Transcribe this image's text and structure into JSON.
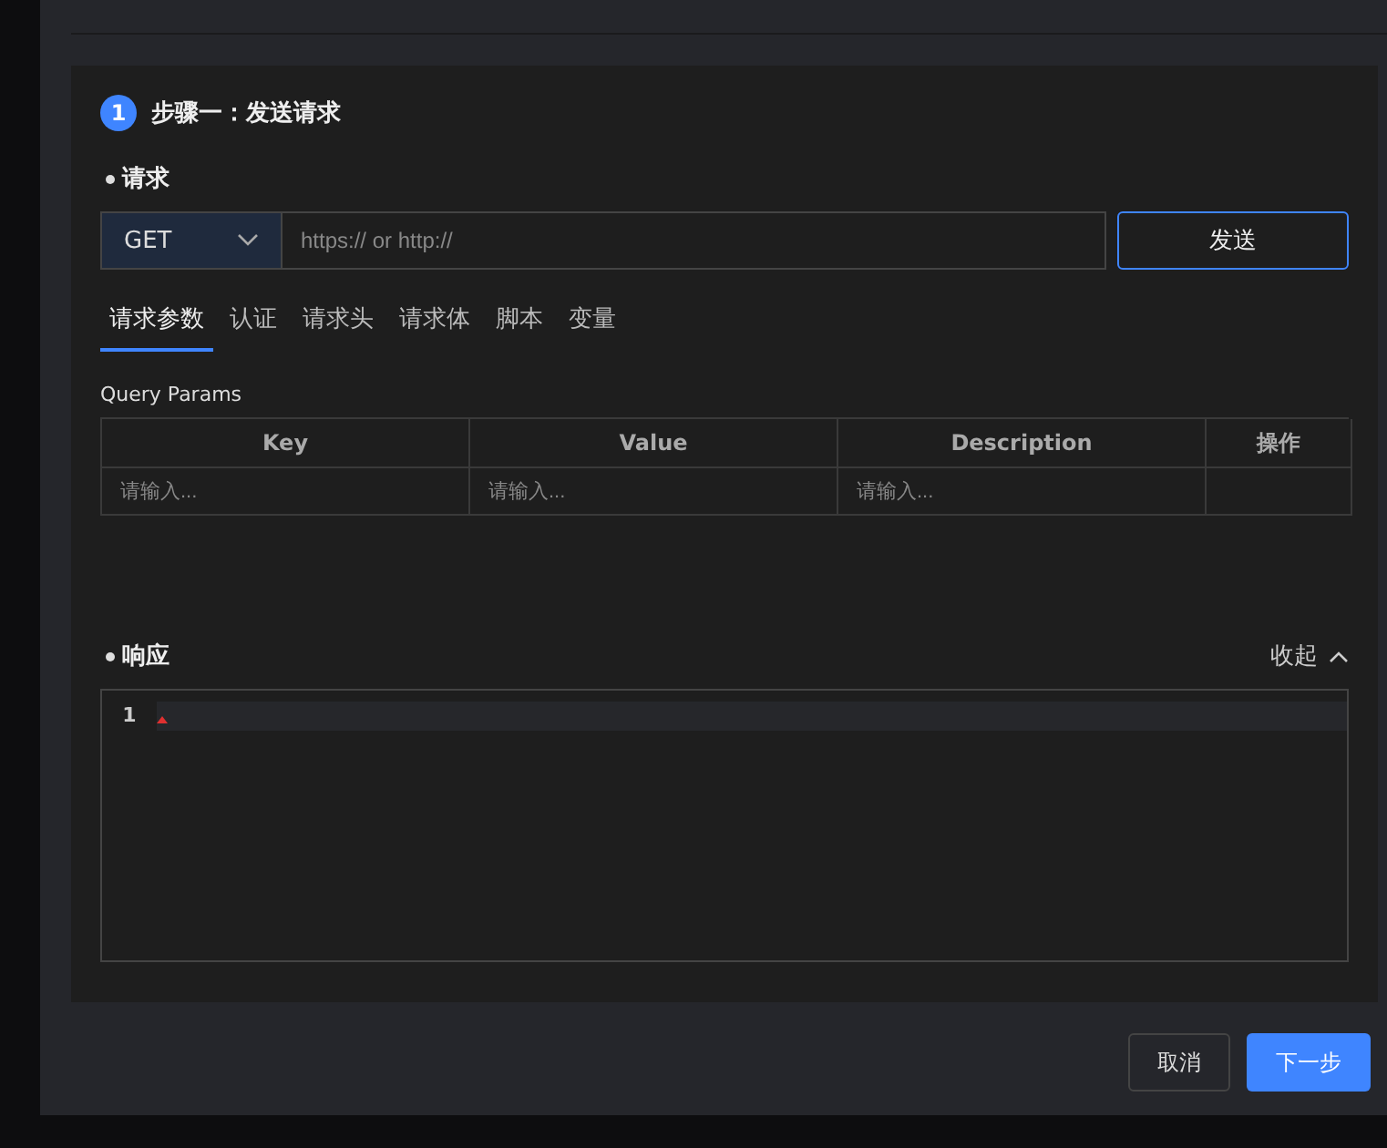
{
  "step": {
    "number": "1",
    "title": "步骤一：发送请求"
  },
  "request": {
    "label": "请求",
    "method": "GET",
    "url_placeholder": "https:// or http://",
    "send": "发送"
  },
  "tabs": [
    {
      "label": "请求参数",
      "selected": true
    },
    {
      "label": "认证",
      "selected": false
    },
    {
      "label": "请求头",
      "selected": false
    },
    {
      "label": "请求体",
      "selected": false
    },
    {
      "label": "脚本",
      "selected": false
    },
    {
      "label": "变量",
      "selected": false
    }
  ],
  "query_params": {
    "title": "Query Params",
    "columns": [
      "Key",
      "Value",
      "Description",
      "操作"
    ],
    "rows": [
      {
        "placeholders": [
          "请输入...",
          "请输入...",
          "请输入..."
        ]
      }
    ]
  },
  "response": {
    "label": "响应",
    "toggle": "收起",
    "line_numbers": [
      "1"
    ]
  },
  "footer": {
    "cancel": "取消",
    "next": "下一步"
  }
}
